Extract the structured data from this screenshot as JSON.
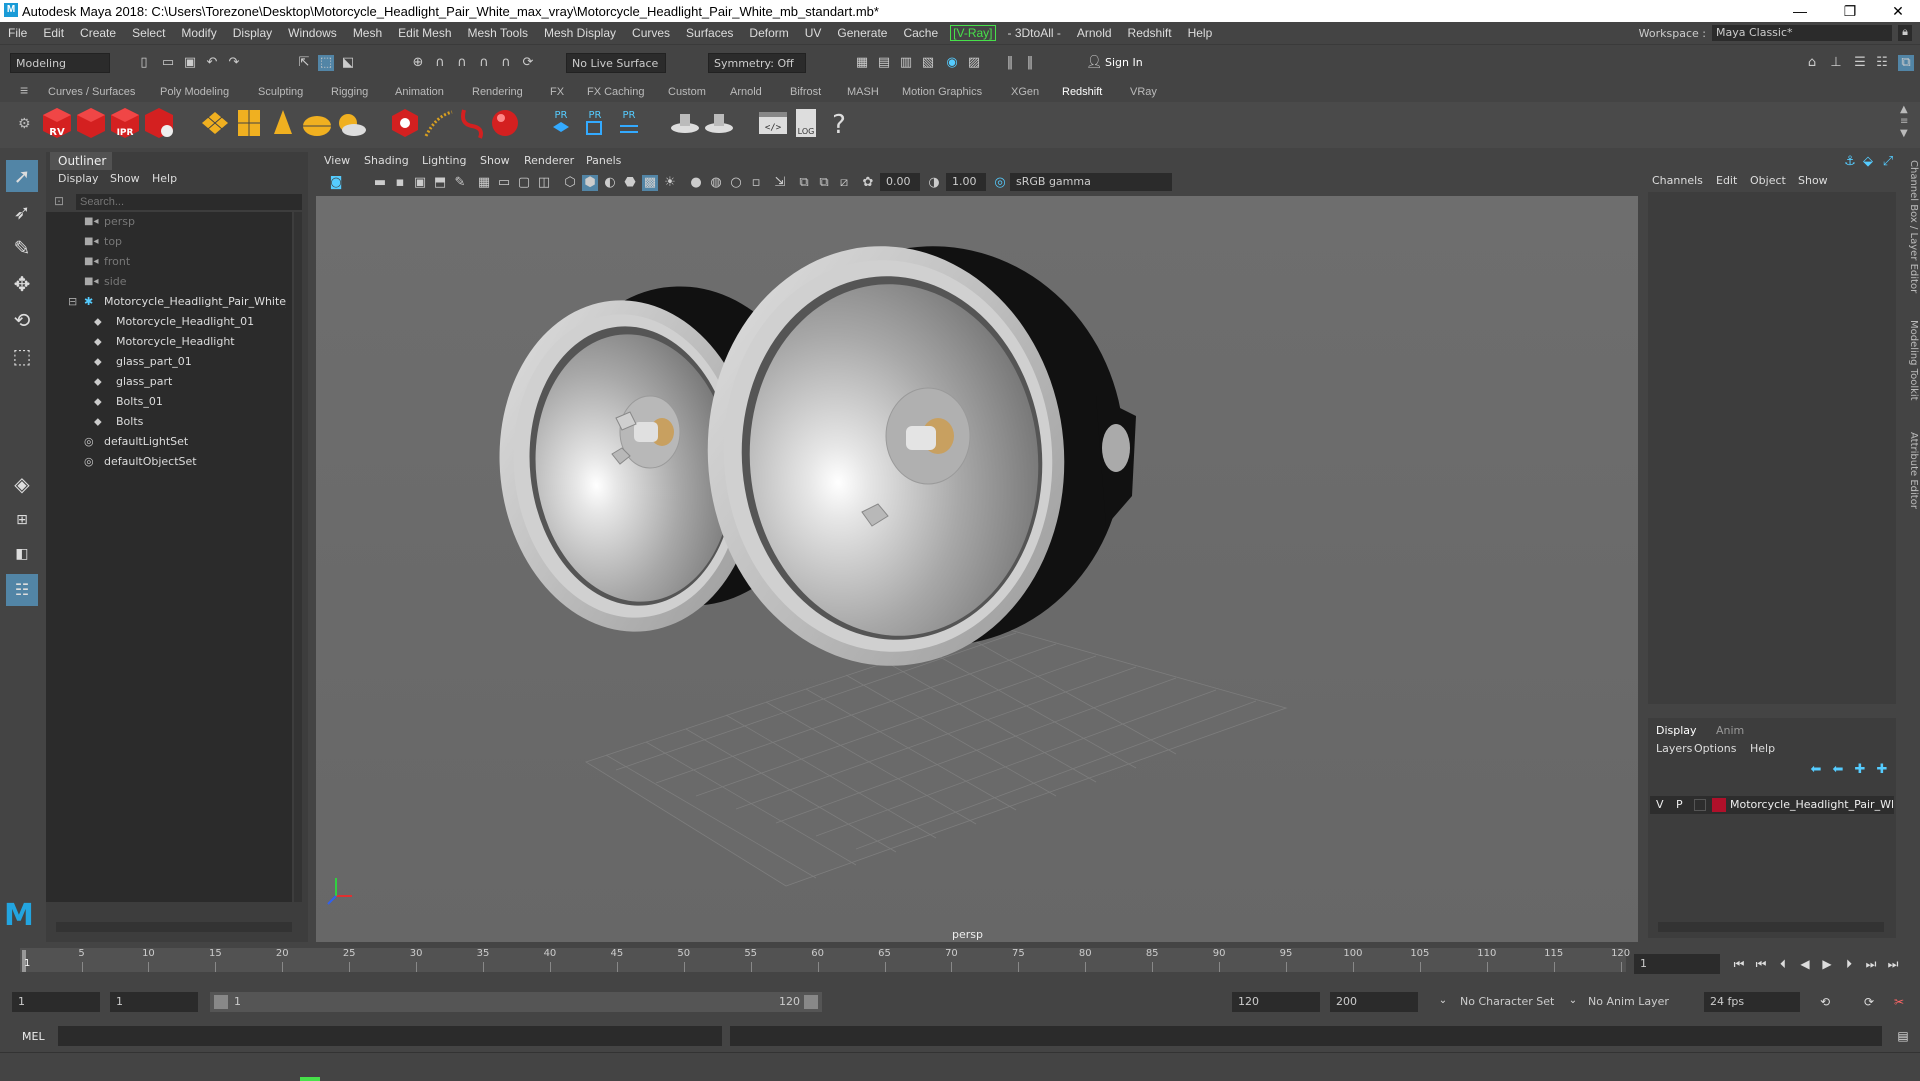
{
  "window": {
    "title": "Autodesk Maya 2018: C:\\Users\\Torezone\\Desktop\\Motorcycle_Headlight_Pair_White_max_vray\\Motorcycle_Headlight_Pair_White_mb_standart.mb*",
    "controls": [
      "—",
      "❐",
      "✕"
    ]
  },
  "menubar": {
    "items": [
      "File",
      "Edit",
      "Create",
      "Select",
      "Modify",
      "Display",
      "Windows",
      "Mesh",
      "Edit Mesh",
      "Mesh Tools",
      "Mesh Display",
      "Curves",
      "Surfaces",
      "Deform",
      "UV",
      "Generate",
      "Cache",
      "[V-Ray]",
      "- 3DtoAll -",
      "Arnold",
      "Redshift",
      "Help"
    ],
    "workspace_label": "Workspace :",
    "workspace_value": "Maya Classic*"
  },
  "statusline": {
    "mode": "Modeling",
    "live_surface": "No Live Surface",
    "symmetry": "Symmetry: Off",
    "sign_in": "Sign In"
  },
  "shelf": {
    "tabs": [
      "Curves / Surfaces",
      "Poly Modeling",
      "Sculpting",
      "Rigging",
      "Animation",
      "Rendering",
      "FX",
      "FX Caching",
      "Custom",
      "Arnold",
      "Bifrost",
      "MASH",
      "Motion Graphics",
      "XGen",
      "Redshift",
      "VRay"
    ],
    "active_tab": "Redshift",
    "icon_labels": [
      "RV",
      "IPR",
      "PR",
      "PR",
      "PR",
      "LOG",
      "?"
    ]
  },
  "outliner": {
    "title": "Outliner",
    "menu": [
      "Display",
      "Show",
      "Help"
    ],
    "search_placeholder": "Search...",
    "cameras": [
      "persp",
      "top",
      "front",
      "side"
    ],
    "group": "Motorcycle_Headlight_Pair_White_nc",
    "children": [
      "Motorcycle_Headlight_01",
      "Motorcycle_Headlight",
      "glass_part_01",
      "glass_part",
      "Bolts_01",
      "Bolts"
    ],
    "sets": [
      "defaultLightSet",
      "defaultObjectSet"
    ]
  },
  "viewport": {
    "menu": [
      "View",
      "Shading",
      "Lighting",
      "Show",
      "Renderer",
      "Panels"
    ],
    "exposure": "0.00",
    "gamma": "1.00",
    "color_space": "sRGB gamma",
    "camera_label": "persp"
  },
  "channelbox": {
    "menu": [
      "Channels",
      "Edit",
      "Object",
      "Show"
    ],
    "side_tabs": [
      "Channel Box / Layer Editor",
      "Modeling Toolkit",
      "Attribute Editor"
    ]
  },
  "layers": {
    "tabs": [
      "Display",
      "Anim"
    ],
    "active_tab": "Display",
    "menu": [
      "Layers",
      "Options",
      "Help"
    ],
    "row": {
      "v": "V",
      "p": "P",
      "name": "Motorcycle_Headlight_Pair_Wl",
      "color": "#b0102a"
    }
  },
  "timeline": {
    "ticks": [
      "5",
      "10",
      "15",
      "20",
      "25",
      "30",
      "35",
      "40",
      "45",
      "50",
      "55",
      "60",
      "65",
      "70",
      "75",
      "80",
      "85",
      "90",
      "95",
      "100",
      "105",
      "110",
      "115",
      "120"
    ],
    "start_tick": "1",
    "current_frame": "1"
  },
  "range": {
    "start": "1",
    "playback_start": "1",
    "slider_start": "1",
    "slider_end": "120",
    "playback_end": "120",
    "end": "200",
    "character_set": "No Character Set",
    "anim_layer": "No Anim Layer",
    "fps": "24 fps"
  },
  "cmdline": {
    "label": "MEL"
  },
  "colors": {
    "accent": "#47e04a",
    "selection": "#5285a6",
    "redshift_red": "#d42020"
  }
}
